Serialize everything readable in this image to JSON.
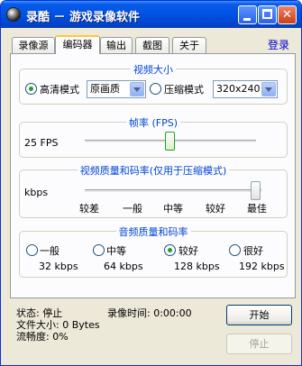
{
  "window": {
    "title": "录酷 － 游戏录像软件",
    "icon": "app-record-icon",
    "controls": [
      "minimize-icon",
      "maximize-icon",
      "close-icon"
    ]
  },
  "tabs": [
    {
      "label": "录像源",
      "active": false
    },
    {
      "label": "编码器",
      "active": true
    },
    {
      "label": "输出",
      "active": false
    },
    {
      "label": "截图",
      "active": false
    },
    {
      "label": "关于",
      "active": false
    }
  ],
  "login_label": "登录",
  "video_size": {
    "title": "视频大小",
    "hd_mode": {
      "label": "高清模式",
      "selected": true,
      "combo_value": "原画质"
    },
    "compressed_mode": {
      "label": "压缩模式",
      "selected": false,
      "combo_value": "320x240"
    }
  },
  "frame_rate": {
    "title": "帧率 (FPS)",
    "value_label": "25 FPS",
    "level": 0.5
  },
  "video_quality": {
    "title": "视频质量和码率(仅用于压缩模式)",
    "unit_label": "kbps",
    "levels": [
      "较差",
      "一般",
      "中等",
      "较好",
      "最佳"
    ],
    "selected_index": 4
  },
  "audio_quality": {
    "title": "音频质量和码率",
    "options": [
      {
        "label": "一般",
        "bitrate": "32 kbps",
        "selected": false
      },
      {
        "label": "中等",
        "bitrate": "64 kbps",
        "selected": false
      },
      {
        "label": "较好",
        "bitrate": "128 kbps",
        "selected": true
      },
      {
        "label": "很好",
        "bitrate": "192 kbps",
        "selected": false
      }
    ]
  },
  "status": {
    "state": "状态: 停止",
    "record_time": "录像时间: 0:00:00",
    "file_size": "文件大小: 0 Bytes",
    "fluency": "流畅度: 0%"
  },
  "buttons": {
    "start": "开始",
    "stop": "停止"
  },
  "colors": {
    "accent": "#0046d5",
    "titlebar": "#0054e3",
    "selected_radio": "#21a121"
  }
}
